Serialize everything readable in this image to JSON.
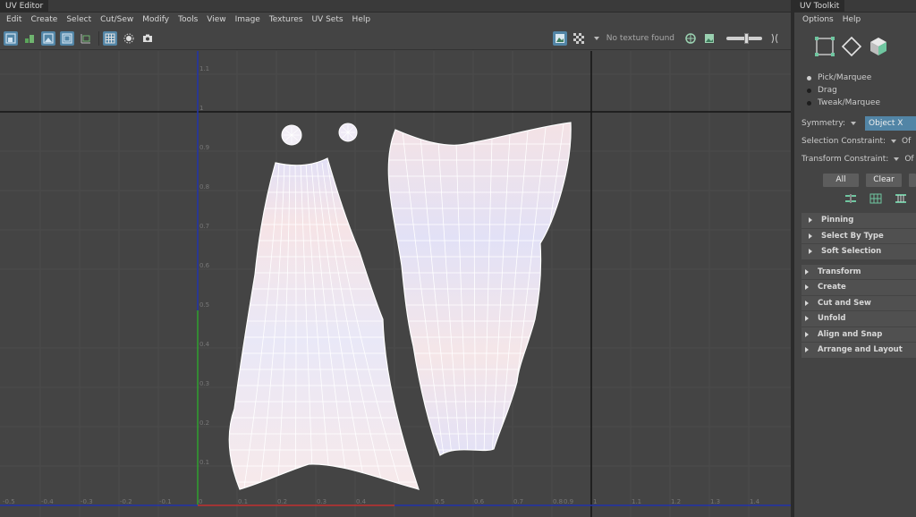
{
  "uv_editor": {
    "title": "UV Editor",
    "menus": [
      "Edit",
      "Create",
      "Select",
      "Cut/Sew",
      "Modify",
      "Tools",
      "View",
      "Image",
      "Textures",
      "UV Sets",
      "Help"
    ],
    "texture_label": "No texture found",
    "grid": {
      "x_ticks": [
        "-0.5",
        "-0.4",
        "-0.3",
        "-0.2",
        "-0.1",
        "0",
        "0.1",
        "0.2",
        "0.3",
        "0.4",
        "0.5",
        "0.6",
        "0.7",
        "0.8",
        "0.9",
        "1",
        "1.1",
        "1.2",
        "1.3",
        "1.4"
      ],
      "y_ticks": [
        "1.1",
        "1",
        "0.9",
        "0.8",
        "0.7",
        "0.6",
        "0.5",
        "0.4",
        "0.3",
        "0.2",
        "0.1"
      ]
    },
    "colors": {
      "selected_tool": "#5285a6",
      "u_axis": "#c03030",
      "v_axis": "#2fa02f",
      "axis_blue": "#2233aa"
    }
  },
  "uv_toolkit": {
    "title": "UV Toolkit",
    "menus": [
      "Options",
      "Help"
    ],
    "selection_icons": [
      "vertex-select-icon",
      "edge-select-icon",
      "face-select-icon"
    ],
    "modes": [
      {
        "label": "Pick/Marquee",
        "selected": true
      },
      {
        "label": "Drag",
        "selected": false
      },
      {
        "label": "Tweak/Marquee",
        "selected": false
      }
    ],
    "symmetry_label": "Symmetry:",
    "symmetry_value": "Object X",
    "selection_constraint_label": "Selection Constraint:",
    "selection_constraint_value": "Of",
    "transform_constraint_label": "Transform Constraint:",
    "transform_constraint_value": "Of",
    "buttons": [
      "All",
      "Clear"
    ],
    "subsections": [
      "Pinning",
      "Select By Type",
      "Soft Selection"
    ],
    "sections": [
      "Transform",
      "Create",
      "Cut and Sew",
      "Unfold",
      "Align and Snap",
      "Arrange and Layout"
    ]
  }
}
